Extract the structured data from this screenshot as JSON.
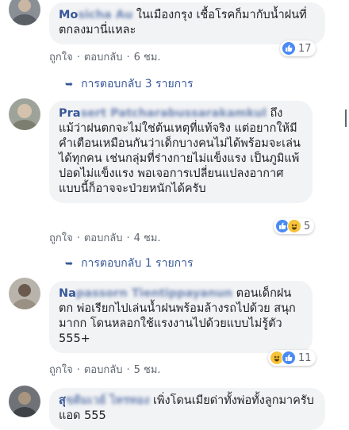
{
  "comments": [
    {
      "author_visible": "Mo",
      "author_blurred": "sicha Au",
      "text": "ในเมืองกรุง เชื้อโรคก็มากับน้ำฝนที่ตกลงมานี่แหละ",
      "reply_count_text": "การตอบกลับ 3 รายการ",
      "time": "6 ชม.",
      "reaction_count": "17",
      "reactions": [
        "like-icon"
      ]
    },
    {
      "author_visible": "Pra",
      "author_blurred": "sert Patcharabussarakamkul",
      "text": "ถึงแม้ว่าฝนตกจะไม่ใช่ต้นเหตุที่แท้จริง แต่อยากให้มีคำเตือนเหมือนกันว่าเด็กบางคนไม่ได้พร้อมจะเล่นได้ทุกคน เช่นกลุ่มที่ร่างกายไม่แข็งแรง เป็นภูมิแพ้ ปอดไม่แข็งแรง พอเจอการเปลี่ยนแปลงอากาศแบบนี้ก็อาจจะป่วยหนักได้ครับ",
      "reply_count_text": "การตอบกลับ 1 รายการ",
      "time": "4 ชม.",
      "reaction_count": "5",
      "reactions": [
        "like-icon",
        "haha-icon"
      ]
    },
    {
      "author_visible": "Na",
      "author_blurred": "passorn Tientippayanun",
      "text": "ตอนเด็กฝนตก พ่อเรียกไปเล่นน้ำฝนพร้อมล้างรถไปด้วย สนุกมากก โดนหลอกใช้แรงงานไปด้วยแบบไม่รู้ตัว 555+",
      "time": "5 ชม.",
      "reaction_count": "11",
      "reactions": [
        "haha-icon",
        "like-icon"
      ]
    },
    {
      "author_visible": "ส",
      "author_blurred": "ุขดิมเวย์ ไทรทอง",
      "text": "เพิ่งโดนเมียด่าทั้งพ่อทั้งลูกมาครับแอด 555"
    }
  ],
  "labels": {
    "like": "ถูกใจ",
    "reply": "ตอบกลับ",
    "separator": "·"
  },
  "colors": {
    "author": "#385898",
    "bubble": "#f2f3f5",
    "meta": "#606770",
    "like": "#4a8af4",
    "haha": "#f7c33a"
  }
}
